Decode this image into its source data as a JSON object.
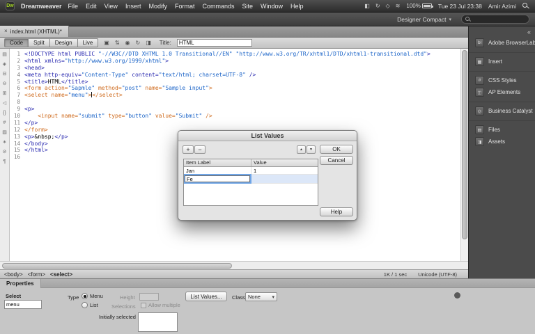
{
  "menubar": {
    "app_icon": "Dw",
    "app_name": "Dreamweaver",
    "menus": [
      "File",
      "Edit",
      "View",
      "Insert",
      "Modify",
      "Format",
      "Commands",
      "Site",
      "Window",
      "Help"
    ],
    "status_icons": [
      {
        "name": "display-icon",
        "glyph": "◧"
      },
      {
        "name": "time-machine-icon",
        "glyph": "↻"
      },
      {
        "name": "bluetooth-icon",
        "glyph": "◇"
      },
      {
        "name": "wifi-icon",
        "glyph": "≋"
      }
    ],
    "battery_percent": "100%",
    "datetime": "Tue 23 Jul 23:38",
    "user_name": "Amir Azimi"
  },
  "appbar": {
    "workspace_switcher": "Designer Compact"
  },
  "tabbar": {
    "tab_title": "index.html (XHTML)*"
  },
  "doc_toolbar": {
    "modes": [
      "Code",
      "Split",
      "Design",
      "Live"
    ],
    "active_mode": "Code",
    "icons": [
      {
        "name": "multiscreen-preview-icon",
        "glyph": "▣"
      },
      {
        "name": "file-management-icon",
        "glyph": "⇅"
      },
      {
        "name": "preview-in-browser-icon",
        "glyph": "◉"
      },
      {
        "name": "refresh-icon",
        "glyph": "↻"
      },
      {
        "name": "view-options-icon",
        "glyph": "◨"
      }
    ],
    "title_label": "Title:",
    "title_value": "HTML"
  },
  "coding_toolbar": [
    {
      "name": "open-documents-icon",
      "glyph": "▤"
    },
    {
      "name": "code-navigator-icon",
      "glyph": "◈"
    },
    {
      "name": "collapse-full-tag-icon",
      "glyph": "⊟"
    },
    {
      "name": "collapse-selection-icon",
      "glyph": "⊖"
    },
    {
      "name": "expand-all-icon",
      "glyph": "⊞"
    },
    {
      "name": "select-parent-tag-icon",
      "glyph": "◁"
    },
    {
      "name": "balance-braces-icon",
      "glyph": "{}"
    },
    {
      "name": "line-numbers-icon",
      "glyph": "#"
    },
    {
      "name": "highlight-invalid-code-icon",
      "glyph": "▨"
    },
    {
      "name": "apply-comment-icon",
      "glyph": "∗"
    },
    {
      "name": "remove-comment-icon",
      "glyph": "⊘"
    },
    {
      "name": "format-source-code-icon",
      "glyph": "¶"
    }
  ],
  "code": {
    "lines": [
      {
        "n": "1",
        "tokens": [
          [
            "t",
            "<!DOCTYPE html PUBLIC "
          ],
          [
            "v",
            "\"-//W3C//DTD XHTML 1.0 Transitional//EN\""
          ],
          [
            "t",
            " "
          ],
          [
            "v",
            "\"http://www.w3.org/TR/xhtml1/DTD/xhtml1-transitional.dtd\""
          ],
          [
            "t",
            ">"
          ]
        ]
      },
      {
        "n": "2",
        "tokens": [
          [
            "t",
            "<html xmlns="
          ],
          [
            "v",
            "\"http://www.w3.org/1999/xhtml\""
          ],
          [
            "t",
            ">"
          ]
        ]
      },
      {
        "n": "3",
        "tokens": [
          [
            "t",
            "<head>"
          ]
        ]
      },
      {
        "n": "4",
        "tokens": [
          [
            "t",
            "<meta http-equiv="
          ],
          [
            "v",
            "\"Content-Type\""
          ],
          [
            "t",
            " content="
          ],
          [
            "v",
            "\"text/html; charset=UTF-8\""
          ],
          [
            "t",
            " />"
          ]
        ]
      },
      {
        "n": "5",
        "tokens": [
          [
            "t",
            "<title>"
          ],
          [
            "x",
            "HTML"
          ],
          [
            "t",
            "</title>"
          ]
        ]
      },
      {
        "n": "6",
        "tokens": [
          [
            "f",
            "<form action="
          ],
          [
            "v",
            "\"Sapmle\""
          ],
          [
            "f",
            " method="
          ],
          [
            "v",
            "\"post\""
          ],
          [
            "f",
            " name="
          ],
          [
            "v",
            "\"Sample input\""
          ],
          [
            "f",
            ">"
          ]
        ]
      },
      {
        "n": "7",
        "tokens": [
          [
            "f",
            "<select name="
          ],
          [
            "v",
            "\"menu\""
          ],
          [
            "f",
            ">"
          ],
          [
            "caret",
            ""
          ],
          [
            "f",
            "</select>"
          ]
        ]
      },
      {
        "n": "8",
        "tokens": []
      },
      {
        "n": "9",
        "tokens": [
          [
            "t",
            "<p>"
          ]
        ]
      },
      {
        "n": "10",
        "tokens": [
          [
            "x",
            "    "
          ],
          [
            "f",
            "<input name="
          ],
          [
            "v",
            "\"submit\""
          ],
          [
            "f",
            " type="
          ],
          [
            "v",
            "\"button\""
          ],
          [
            "f",
            " value="
          ],
          [
            "v",
            "\"Submit\""
          ],
          [
            "f",
            " />"
          ]
        ]
      },
      {
        "n": "11",
        "tokens": [
          [
            "t",
            "</p>"
          ]
        ]
      },
      {
        "n": "12",
        "tokens": [
          [
            "f",
            "</form>"
          ]
        ]
      },
      {
        "n": "13",
        "tokens": [
          [
            "t",
            "<p>"
          ],
          [
            "x",
            "&nbsp;"
          ],
          [
            "t",
            "</p>"
          ]
        ]
      },
      {
        "n": "14",
        "tokens": [
          [
            "t",
            "</body>"
          ]
        ]
      },
      {
        "n": "15",
        "tokens": [
          [
            "t",
            "</html>"
          ]
        ]
      },
      {
        "n": "16",
        "tokens": []
      }
    ]
  },
  "statusbar": {
    "tag_path": [
      "<body>",
      "<form>",
      "<select>"
    ],
    "file_info": "1K / 1 sec",
    "encoding": "Unicode (UTF-8)"
  },
  "properties": {
    "panel_title": "Properties",
    "select_label": "Select",
    "select_name_value": "menu",
    "type_label": "Type",
    "radio_menu": "Menu",
    "radio_list": "List",
    "height_label": "Height",
    "selections_label": "Selections",
    "allow_multiple_label": "Allow multiple",
    "list_values_button": "List Values...",
    "class_label": "Class",
    "class_value": "None",
    "initially_selected_label": "Initially selected"
  },
  "sidebar": {
    "collapse_label": "«",
    "groups": [
      {
        "panels": [
          {
            "name": "adobe-browserlab",
            "label": "Adobe BrowserLab",
            "glyph": "bl"
          }
        ]
      },
      {
        "panels": [
          {
            "name": "insert",
            "label": "Insert",
            "glyph": "▦"
          }
        ]
      },
      {
        "panels": [
          {
            "name": "css-styles",
            "label": "CSS Styles",
            "glyph": "#"
          },
          {
            "name": "ap-elements",
            "label": "AP Elements",
            "glyph": "◫"
          }
        ]
      },
      {
        "panels": [
          {
            "name": "business-catalyst",
            "label": "Business Catalyst",
            "glyph": "◎"
          }
        ]
      },
      {
        "panels": [
          {
            "name": "files",
            "label": "Files",
            "glyph": "▤"
          },
          {
            "name": "assets",
            "label": "Assets",
            "glyph": "◨"
          }
        ]
      }
    ]
  },
  "dialog": {
    "title": "List Values",
    "toolbar": {
      "add": "+",
      "remove": "−",
      "up": "▲",
      "down": "▼"
    },
    "columns": [
      "Item Label",
      "Value"
    ],
    "rows": [
      {
        "label": "Jan",
        "value": "1"
      }
    ],
    "editing": {
      "label_value": "Fe"
    },
    "buttons": {
      "ok": "OK",
      "cancel": "Cancel",
      "help": "Help"
    }
  }
}
